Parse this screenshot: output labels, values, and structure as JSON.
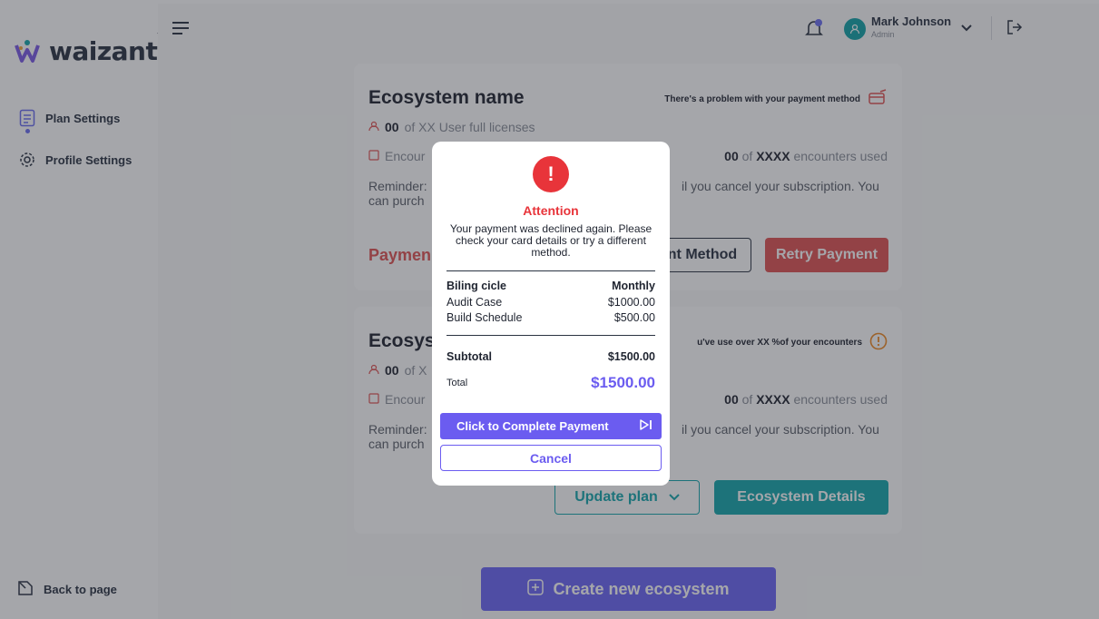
{
  "brand": {
    "name": "waizant",
    "trademark": "™"
  },
  "sidebar": {
    "items": [
      {
        "label": "Plan Settings",
        "icon": "document-list-icon"
      },
      {
        "label": "Profile Settings",
        "icon": "gear-icon"
      }
    ],
    "back_label": "Back to page"
  },
  "header": {
    "user_name": "Mark Johnson",
    "user_role": "Admin"
  },
  "cards": [
    {
      "title": "Ecosystem name",
      "notice": "There's a problem with your payment method",
      "licenses_count": "00",
      "licenses_text": "of XX User full licenses",
      "encounters_label": "Encour",
      "encounters_used": "00",
      "encounters_total": "XXXX",
      "encounters_suffix": "encounters used",
      "reminder_left": "Reminder:",
      "reminder_left2": "can purch",
      "reminder_right": "il you cancel your subscription. You",
      "payment_label": "Paymen",
      "update_method_label": "nt Method",
      "retry_label": "Retry Payment"
    },
    {
      "title": "Ecosys",
      "notice": "u've use over XX %of your encounters",
      "licenses_count": "00",
      "licenses_text": "of X",
      "encounters_label": "Encour",
      "encounters_used": "00",
      "encounters_total": "XXXX",
      "encounters_suffix": "encounters used",
      "reminder_left": "Reminder:",
      "reminder_left2": "can purch",
      "reminder_right": "il you cancel your subscription. You",
      "update_plan_label": "Update plan",
      "details_label": "Ecosystem Details"
    }
  ],
  "create_button_label": "Create new ecosystem",
  "modal": {
    "title": "Attention",
    "message": "Your payment was declined again. Please check your card details or try a different method.",
    "billing_label": "Biling cicle",
    "billing_value": "Monthly",
    "items": [
      {
        "name": "Audit Case",
        "price": "$1000.00"
      },
      {
        "name": "Build Schedule",
        "price": "$500.00"
      }
    ],
    "subtotal_label": "Subtotal",
    "subtotal_value": "$1500.00",
    "total_label": "Total",
    "total_value": "$1500.00",
    "pay_label": "Click to Complete Payment",
    "cancel_label": "Cancel"
  },
  "colors": {
    "accent": "#6b5cf0",
    "danger": "#e8343a",
    "teal": "#16a7ad"
  }
}
